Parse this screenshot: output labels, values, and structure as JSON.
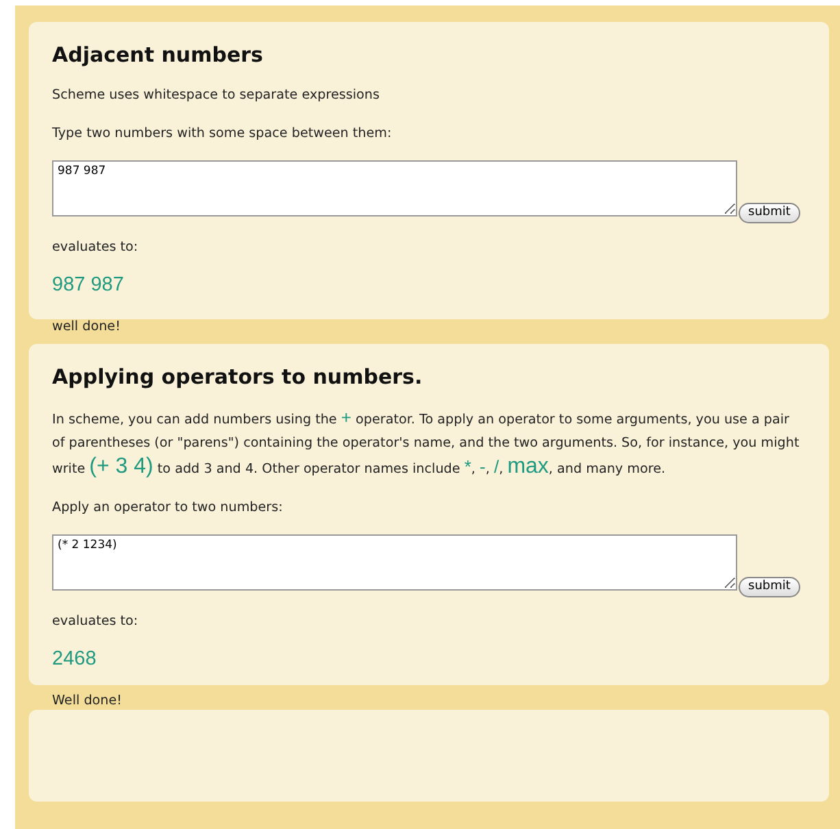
{
  "sections": [
    {
      "title": "Adjacent numbers",
      "intro": [
        {
          "kind": "text",
          "text": "Scheme uses whitespace to separate expressions"
        }
      ],
      "prompt": "Type two numbers with some space between them:",
      "input": "987 987",
      "button": "submit",
      "result_label": "evaluates to:",
      "result": "987 987",
      "feedback": "well done!"
    },
    {
      "title": "Applying operators to numbers.",
      "intro": [
        {
          "kind": "text",
          "text": "In scheme, you can add numbers using the "
        },
        {
          "kind": "code",
          "text": "+"
        },
        {
          "kind": "text",
          "text": " operator. To apply an operator to some arguments, you use a pair of parentheses (or \"parens\") containing the operator's name, and the two arguments. So, for instance, you might write "
        },
        {
          "kind": "code",
          "text": "(+ 3 4)"
        },
        {
          "kind": "text",
          "text": " to add 3 and 4. Other operator names include "
        },
        {
          "kind": "code",
          "text": "*"
        },
        {
          "kind": "text",
          "text": ", "
        },
        {
          "kind": "code",
          "text": "-"
        },
        {
          "kind": "text",
          "text": ", "
        },
        {
          "kind": "code",
          "text": "/"
        },
        {
          "kind": "text",
          "text": ", "
        },
        {
          "kind": "code",
          "text": "max"
        },
        {
          "kind": "text",
          "text": ", and many more."
        }
      ],
      "prompt": "Apply an operator to two numbers:",
      "input": "(* 2 1234)",
      "button": "submit",
      "result_label": "evaluates to:",
      "result": "2468",
      "feedback": "Well done!"
    }
  ]
}
